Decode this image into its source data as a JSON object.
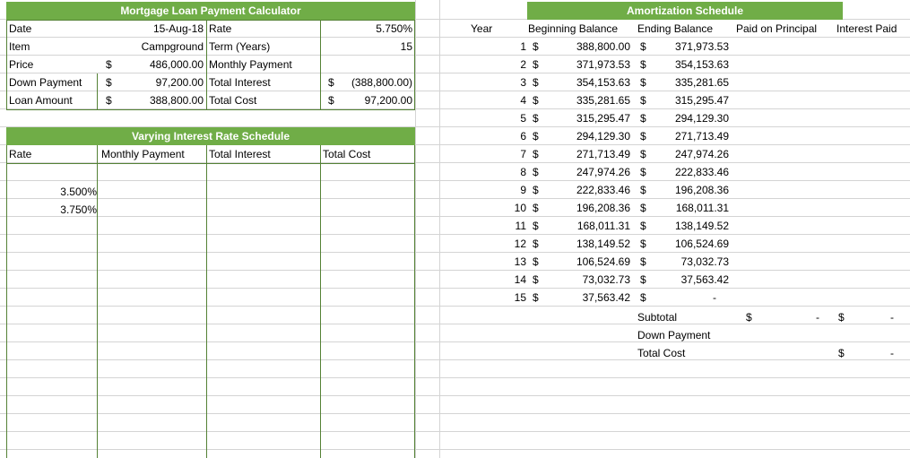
{
  "calculator": {
    "title": "Mortgage Loan Payment Calculator",
    "labels": [
      "Date",
      "Item",
      "Price",
      "Down Payment",
      "Loan Amount"
    ],
    "values": [
      "15-Aug-18",
      "Campground",
      "486,000.00",
      "97,200.00",
      "388,800.00"
    ],
    "labels2": [
      "Rate",
      "Term (Years)",
      "Monthly Payment",
      "Total Interest",
      "Total Cost"
    ],
    "values2": [
      "5.750%",
      "15",
      "",
      "(388,800.00)",
      "97,200.00"
    ],
    "currency": "$"
  },
  "varying": {
    "title": "Varying Interest Rate Schedule",
    "headers": [
      "Rate",
      "Monthly Payment",
      "Total Interest",
      "Total Cost"
    ],
    "rates": [
      "3.500%",
      "3.750%"
    ]
  },
  "amortization": {
    "title": "Amortization Schedule",
    "headers": [
      "Year",
      "Beginning Balance",
      "Ending Balance",
      "Paid on Principal",
      "Interest Paid"
    ],
    "rows": [
      {
        "year": "1",
        "begin": "388,800.00",
        "end": "371,973.53"
      },
      {
        "year": "2",
        "begin": "371,973.53",
        "end": "354,153.63"
      },
      {
        "year": "3",
        "begin": "354,153.63",
        "end": "335,281.65"
      },
      {
        "year": "4",
        "begin": "335,281.65",
        "end": "315,295.47"
      },
      {
        "year": "5",
        "begin": "315,295.47",
        "end": "294,129.30"
      },
      {
        "year": "6",
        "begin": "294,129.30",
        "end": "271,713.49"
      },
      {
        "year": "7",
        "begin": "271,713.49",
        "end": "247,974.26"
      },
      {
        "year": "8",
        "begin": "247,974.26",
        "end": "222,833.46"
      },
      {
        "year": "9",
        "begin": "222,833.46",
        "end": "196,208.36"
      },
      {
        "year": "10",
        "begin": "196,208.36",
        "end": "168,011.31"
      },
      {
        "year": "11",
        "begin": "168,011.31",
        "end": "138,149.52"
      },
      {
        "year": "12",
        "begin": "138,149.52",
        "end": "106,524.69"
      },
      {
        "year": "13",
        "begin": "106,524.69",
        "end": "73,032.73"
      },
      {
        "year": "14",
        "begin": "73,032.73",
        "end": "37,563.42"
      },
      {
        "year": "15",
        "begin": "37,563.42",
        "end": "-"
      }
    ],
    "subtotal_label": "Subtotal",
    "down_payment_label": "Down Payment",
    "total_cost_label": "Total Cost",
    "dash": "-",
    "currency": "$"
  }
}
